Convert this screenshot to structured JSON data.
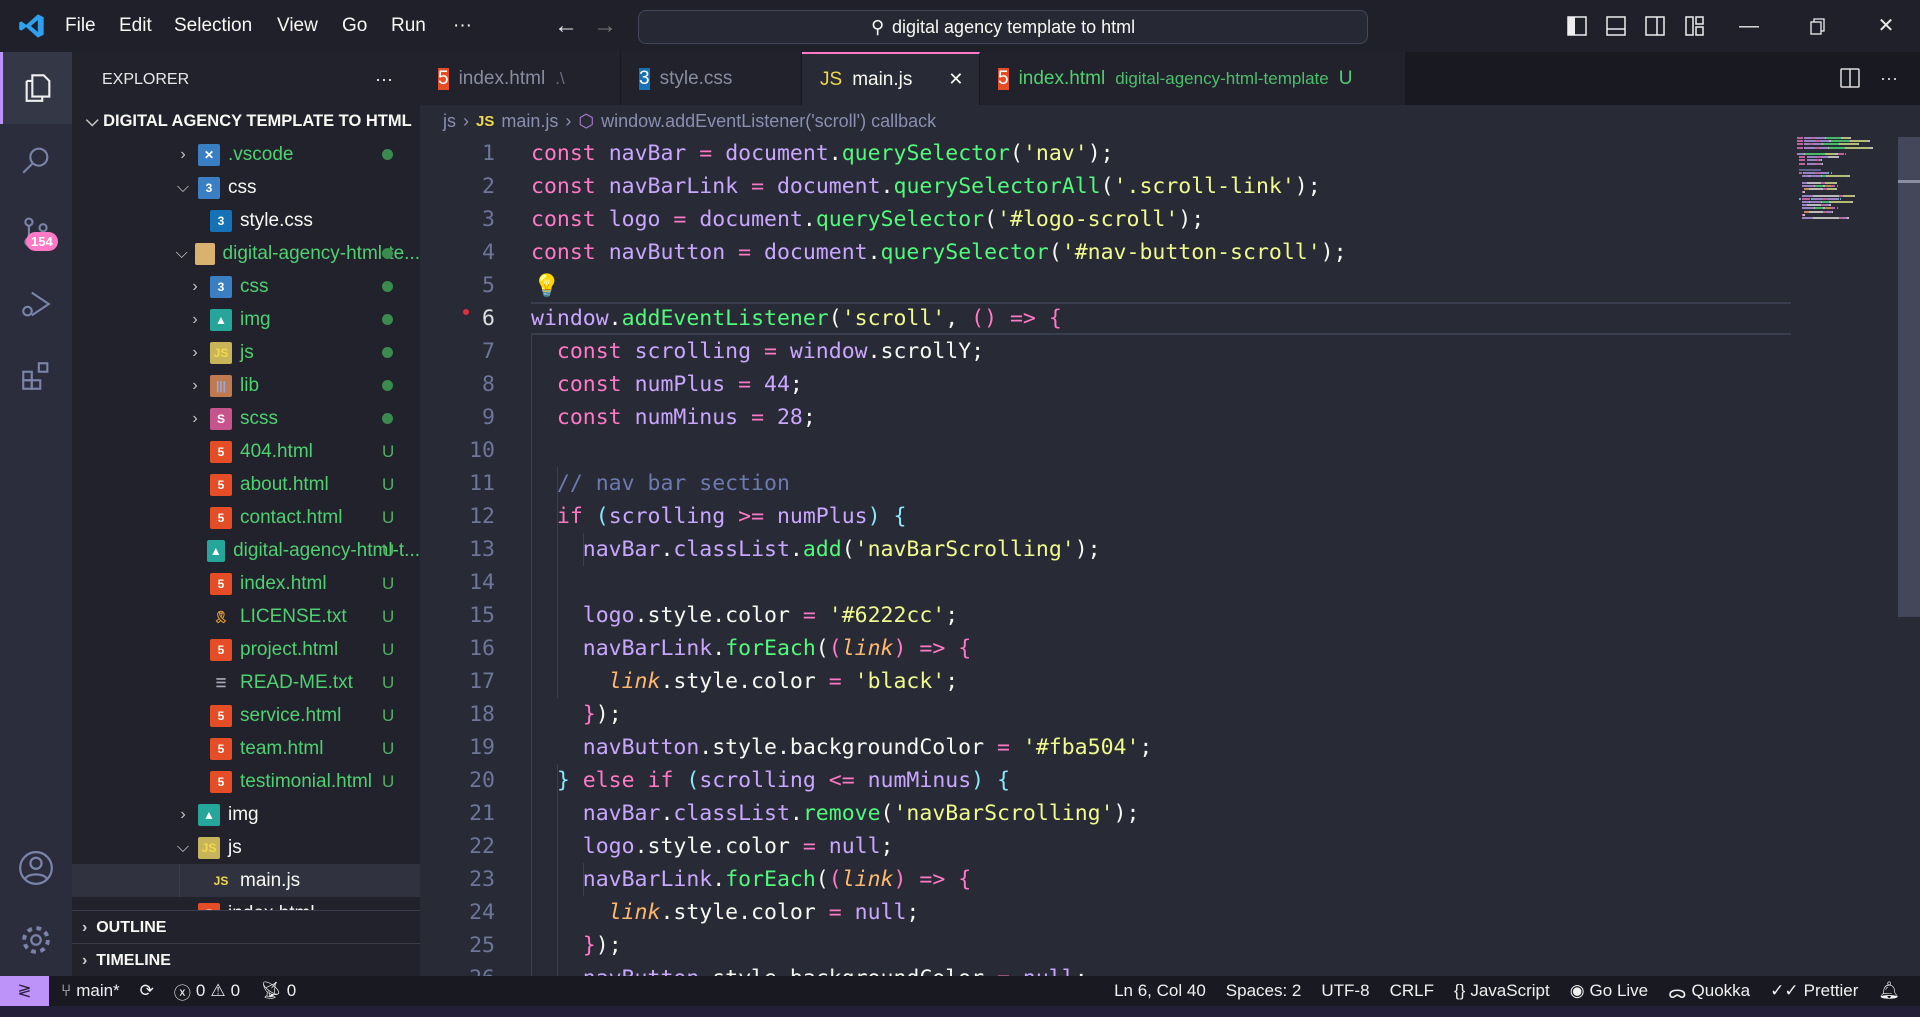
{
  "titlebar": {
    "menu": [
      "File",
      "Edit",
      "Selection",
      "View",
      "Go",
      "Run",
      "···"
    ],
    "search_text": "digital agency template to html"
  },
  "activity": {
    "scm_badge": "154"
  },
  "sidebar": {
    "title": "EXPLORER",
    "more": "···",
    "root": "DIGITAL AGENCY TEMPLATE TO HTML",
    "items": [
      {
        "name": ".vscode",
        "depth": 1,
        "kind": "folder",
        "expanded": false,
        "icon": "vscode-folder",
        "git": "dot",
        "green": true
      },
      {
        "name": "css",
        "depth": 1,
        "kind": "folder",
        "expanded": true,
        "icon": "css-folder",
        "git": "",
        "green": false
      },
      {
        "name": "style.css",
        "depth": 2,
        "kind": "file",
        "icon": "css",
        "git": "",
        "green": false
      },
      {
        "name": "digital-agency-html-te...",
        "depth": 1,
        "kind": "folder",
        "expanded": true,
        "icon": "folder",
        "git": "dot",
        "green": true
      },
      {
        "name": "css",
        "depth": 2,
        "kind": "folder",
        "expanded": false,
        "icon": "css-folder",
        "git": "dot",
        "green": true
      },
      {
        "name": "img",
        "depth": 2,
        "kind": "folder",
        "expanded": false,
        "icon": "img-folder",
        "git": "dot",
        "green": true
      },
      {
        "name": "js",
        "depth": 2,
        "kind": "folder",
        "expanded": false,
        "icon": "js-folder",
        "git": "dot",
        "green": true
      },
      {
        "name": "lib",
        "depth": 2,
        "kind": "folder",
        "expanded": false,
        "icon": "lib-folder",
        "git": "dot",
        "green": true
      },
      {
        "name": "scss",
        "depth": 2,
        "kind": "folder",
        "expanded": false,
        "icon": "scss-folder",
        "git": "dot",
        "green": true
      },
      {
        "name": "404.html",
        "depth": 2,
        "kind": "file",
        "icon": "html",
        "git": "U",
        "green": true
      },
      {
        "name": "about.html",
        "depth": 2,
        "kind": "file",
        "icon": "html",
        "git": "U",
        "green": true
      },
      {
        "name": "contact.html",
        "depth": 2,
        "kind": "file",
        "icon": "html",
        "git": "U",
        "green": true
      },
      {
        "name": "digital-agency-html-t...",
        "depth": 2,
        "kind": "file",
        "icon": "image",
        "git": "U",
        "green": true
      },
      {
        "name": "index.html",
        "depth": 2,
        "kind": "file",
        "icon": "html",
        "git": "U",
        "green": true
      },
      {
        "name": "LICENSE.txt",
        "depth": 2,
        "kind": "file",
        "icon": "license",
        "git": "U",
        "green": true
      },
      {
        "name": "project.html",
        "depth": 2,
        "kind": "file",
        "icon": "html",
        "git": "U",
        "green": true
      },
      {
        "name": "READ-ME.txt",
        "depth": 2,
        "kind": "file",
        "icon": "text",
        "git": "U",
        "green": true
      },
      {
        "name": "service.html",
        "depth": 2,
        "kind": "file",
        "icon": "html",
        "git": "U",
        "green": true
      },
      {
        "name": "team.html",
        "depth": 2,
        "kind": "file",
        "icon": "html",
        "git": "U",
        "green": true
      },
      {
        "name": "testimonial.html",
        "depth": 2,
        "kind": "file",
        "icon": "html",
        "git": "U",
        "green": true
      },
      {
        "name": "img",
        "depth": 1,
        "kind": "folder",
        "expanded": false,
        "icon": "img-folder",
        "git": "",
        "green": false
      },
      {
        "name": "js",
        "depth": 1,
        "kind": "folder",
        "expanded": true,
        "icon": "js-folder",
        "git": "",
        "green": false
      },
      {
        "name": "main.js",
        "depth": 2,
        "kind": "file",
        "icon": "js",
        "git": "",
        "green": false,
        "selected": true
      },
      {
        "name": "index.html",
        "depth": 1,
        "kind": "file",
        "icon": "html",
        "git": "",
        "green": false
      }
    ],
    "outline": "OUTLINE",
    "timeline": "TIMELINE"
  },
  "tabs": [
    {
      "label": "index.html",
      "desc": ".\\",
      "icon": "html",
      "active": false,
      "green": false
    },
    {
      "label": "style.css",
      "desc": "",
      "icon": "css",
      "active": false,
      "green": false
    },
    {
      "label": "main.js",
      "desc": "",
      "icon": "js",
      "active": true,
      "green": false
    },
    {
      "label": "index.html",
      "desc": "digital-agency-html-template",
      "badge": "U",
      "icon": "html",
      "active": false,
      "green": true
    }
  ],
  "breadcrumb": {
    "folder": "js",
    "file_icon": "JS",
    "file": "main.js",
    "symbol": "window.addEventListener('scroll') callback",
    "sep": "›"
  },
  "editor": {
    "current_line": 6,
    "lines": [
      [
        [
          "k",
          "const"
        ],
        [
          "p",
          " "
        ],
        [
          "v",
          "navBar"
        ],
        [
          "o",
          " = "
        ],
        [
          "v",
          "document"
        ],
        [
          "p",
          "."
        ],
        [
          "f",
          "querySelector"
        ],
        [
          "b1",
          "("
        ],
        [
          "s",
          "'nav'"
        ],
        [
          "b1",
          ")"
        ],
        [
          "p",
          ";"
        ]
      ],
      [
        [
          "k",
          "const"
        ],
        [
          "p",
          " "
        ],
        [
          "v",
          "navBarLink"
        ],
        [
          "o",
          " = "
        ],
        [
          "v",
          "document"
        ],
        [
          "p",
          "."
        ],
        [
          "f",
          "querySelectorAll"
        ],
        [
          "b1",
          "("
        ],
        [
          "s",
          "'.scroll-link'"
        ],
        [
          "b1",
          ")"
        ],
        [
          "p",
          ";"
        ]
      ],
      [
        [
          "k",
          "const"
        ],
        [
          "p",
          " "
        ],
        [
          "v",
          "logo"
        ],
        [
          "o",
          " = "
        ],
        [
          "v",
          "document"
        ],
        [
          "p",
          "."
        ],
        [
          "f",
          "querySelector"
        ],
        [
          "b1",
          "("
        ],
        [
          "s",
          "'#logo-scroll'"
        ],
        [
          "b1",
          ")"
        ],
        [
          "p",
          ";"
        ]
      ],
      [
        [
          "k",
          "const"
        ],
        [
          "p",
          " "
        ],
        [
          "v",
          "navButton"
        ],
        [
          "o",
          " = "
        ],
        [
          "v",
          "document"
        ],
        [
          "p",
          "."
        ],
        [
          "f",
          "querySelector"
        ],
        [
          "b1",
          "("
        ],
        [
          "s",
          "'#nav-button-scroll'"
        ],
        [
          "b1",
          ")"
        ],
        [
          "p",
          ";"
        ]
      ],
      [],
      [
        [
          "v",
          "window"
        ],
        [
          "p",
          "."
        ],
        [
          "f",
          "addEventListener"
        ],
        [
          "b1",
          "("
        ],
        [
          "s",
          "'scroll'"
        ],
        [
          "p",
          ", "
        ],
        [
          "b2",
          "()"
        ],
        [
          "o",
          " =>"
        ],
        [
          "p",
          " "
        ],
        [
          "b2",
          "{"
        ]
      ],
      [
        [
          "p",
          "  "
        ],
        [
          "k",
          "const"
        ],
        [
          "p",
          " "
        ],
        [
          "v",
          "scrolling"
        ],
        [
          "o",
          " = "
        ],
        [
          "v",
          "window"
        ],
        [
          "p",
          ".scrollY;"
        ]
      ],
      [
        [
          "p",
          "  "
        ],
        [
          "k",
          "const"
        ],
        [
          "p",
          " "
        ],
        [
          "v",
          "numPlus"
        ],
        [
          "o",
          " = "
        ],
        [
          "n",
          "44"
        ],
        [
          "p",
          ";"
        ]
      ],
      [
        [
          "p",
          "  "
        ],
        [
          "k",
          "const"
        ],
        [
          "p",
          " "
        ],
        [
          "v",
          "numMinus"
        ],
        [
          "o",
          " = "
        ],
        [
          "n",
          "28"
        ],
        [
          "p",
          ";"
        ]
      ],
      [],
      [
        [
          "p",
          "  "
        ],
        [
          "c",
          "// nav bar section"
        ]
      ],
      [
        [
          "p",
          "  "
        ],
        [
          "k",
          "if"
        ],
        [
          "p",
          " "
        ],
        [
          "b3",
          "("
        ],
        [
          "v",
          "scrolling"
        ],
        [
          "o",
          " >= "
        ],
        [
          "v",
          "numPlus"
        ],
        [
          "b3",
          ")"
        ],
        [
          "p",
          " "
        ],
        [
          "b3",
          "{"
        ]
      ],
      [
        [
          "p",
          "    "
        ],
        [
          "v",
          "navBar"
        ],
        [
          "p",
          "."
        ],
        [
          "v",
          "classList"
        ],
        [
          "p",
          "."
        ],
        [
          "f",
          "add"
        ],
        [
          "b1",
          "("
        ],
        [
          "s",
          "'navBarScrolling'"
        ],
        [
          "b1",
          ")"
        ],
        [
          "p",
          ";"
        ]
      ],
      [],
      [
        [
          "p",
          "    "
        ],
        [
          "v",
          "logo"
        ],
        [
          "p",
          ".style.color"
        ],
        [
          "o",
          " = "
        ],
        [
          "s",
          "'#6222cc'"
        ],
        [
          "p",
          ";"
        ]
      ],
      [
        [
          "p",
          "    "
        ],
        [
          "v",
          "navBarLink"
        ],
        [
          "p",
          "."
        ],
        [
          "f",
          "forEach"
        ],
        [
          "b1",
          "("
        ],
        [
          "b2",
          "("
        ],
        [
          "a",
          "link"
        ],
        [
          "b2",
          ")"
        ],
        [
          "o",
          " =>"
        ],
        [
          "p",
          " "
        ],
        [
          "b2",
          "{"
        ]
      ],
      [
        [
          "p",
          "      "
        ],
        [
          "a",
          "link"
        ],
        [
          "p",
          ".style.color"
        ],
        [
          "o",
          " = "
        ],
        [
          "s",
          "'black'"
        ],
        [
          "p",
          ";"
        ]
      ],
      [
        [
          "p",
          "    "
        ],
        [
          "b2",
          "}"
        ],
        [
          "b1",
          ")"
        ],
        [
          "p",
          ";"
        ]
      ],
      [
        [
          "p",
          "    "
        ],
        [
          "v",
          "navButton"
        ],
        [
          "p",
          ".style.backgroundColor"
        ],
        [
          "o",
          " = "
        ],
        [
          "s",
          "'#fba504'"
        ],
        [
          "p",
          ";"
        ]
      ],
      [
        [
          "p",
          "  "
        ],
        [
          "b3",
          "}"
        ],
        [
          "p",
          " "
        ],
        [
          "k",
          "else if"
        ],
        [
          "p",
          " "
        ],
        [
          "b3",
          "("
        ],
        [
          "v",
          "scrolling"
        ],
        [
          "o",
          " <= "
        ],
        [
          "v",
          "numMinus"
        ],
        [
          "b3",
          ")"
        ],
        [
          "p",
          " "
        ],
        [
          "b3",
          "{"
        ]
      ],
      [
        [
          "p",
          "    "
        ],
        [
          "v",
          "navBar"
        ],
        [
          "p",
          "."
        ],
        [
          "v",
          "classList"
        ],
        [
          "p",
          "."
        ],
        [
          "f",
          "remove"
        ],
        [
          "b1",
          "("
        ],
        [
          "s",
          "'navBarScrolling'"
        ],
        [
          "b1",
          ")"
        ],
        [
          "p",
          ";"
        ]
      ],
      [
        [
          "p",
          "    "
        ],
        [
          "v",
          "logo"
        ],
        [
          "p",
          ".style.color"
        ],
        [
          "o",
          " = "
        ],
        [
          "n",
          "null"
        ],
        [
          "p",
          ";"
        ]
      ],
      [
        [
          "p",
          "    "
        ],
        [
          "v",
          "navBarLink"
        ],
        [
          "p",
          "."
        ],
        [
          "f",
          "forEach"
        ],
        [
          "b1",
          "("
        ],
        [
          "b2",
          "("
        ],
        [
          "a",
          "link"
        ],
        [
          "b2",
          ")"
        ],
        [
          "o",
          " =>"
        ],
        [
          "p",
          " "
        ],
        [
          "b2",
          "{"
        ]
      ],
      [
        [
          "p",
          "      "
        ],
        [
          "a",
          "link"
        ],
        [
          "p",
          ".style.color"
        ],
        [
          "o",
          " = "
        ],
        [
          "n",
          "null"
        ],
        [
          "p",
          ";"
        ]
      ],
      [
        [
          "p",
          "    "
        ],
        [
          "b2",
          "}"
        ],
        [
          "b1",
          ")"
        ],
        [
          "p",
          ";"
        ]
      ],
      [
        [
          "p",
          "    "
        ],
        [
          "v",
          "navButton"
        ],
        [
          "p",
          ".style.backgroundColor"
        ],
        [
          "o",
          " = "
        ],
        [
          "n",
          "null"
        ],
        [
          "p",
          ";"
        ]
      ]
    ]
  },
  "status": {
    "branch": "main*",
    "errors": "0",
    "warnings": "0",
    "ports": "0",
    "position": "Ln 6, Col 40",
    "spaces": "Spaces: 2",
    "encoding": "UTF-8",
    "eol": "CRLF",
    "language": "JavaScript",
    "golive": "Go Live",
    "quokka": "Quokka",
    "prettier": "Prettier"
  },
  "colors": {
    "accent": "#bd93f9",
    "keyword": "#ff79c6",
    "function": "#50fa7b",
    "string": "#f1fa8c",
    "git_untracked": "#50b060"
  }
}
